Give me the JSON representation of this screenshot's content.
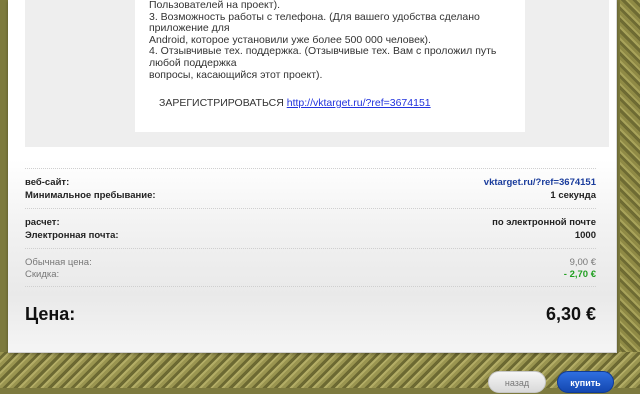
{
  "description_lines": [
    "Пользователей на проект).",
    "3. Возможность работы с телефона. (Для вашего удобства сделано",
    "приложение для",
    "Android, которое установили уже более 500 000 человек).",
    "4. Отзывчивые тех. поддержка. (Отзывчивые тех. Вам с проложил путь",
    "любой поддержка",
    "вопросы, касающийся этот проект)."
  ],
  "register": {
    "text": "ЗАРЕГИСТРИРОВАТЬСЯ",
    "link": "http://vktarget.ru/?ref=3674151"
  },
  "details": {
    "website_label": "веб-сайт:",
    "website_value": "vktarget.ru/?ref=3674151",
    "min_stay_label": "Минимальное пребывание:",
    "min_stay_value": "1 секунда",
    "payment_label": "расчет:",
    "payment_value": "по электронной почте",
    "email_label": "Электронная почта:",
    "email_value": "1000",
    "regular_price_label": "Обычная цена:",
    "regular_price_value": "9,00 €",
    "discount_label": "Скидка:",
    "discount_value": "- 2,70 €",
    "price_label": "Цена:",
    "price_value": "6,30 €"
  },
  "buttons": {
    "back": "назад",
    "buy": "купить"
  },
  "colors": {
    "link": "#2233dd",
    "discount": "#22a022",
    "buy_button": "#1a56c8"
  }
}
